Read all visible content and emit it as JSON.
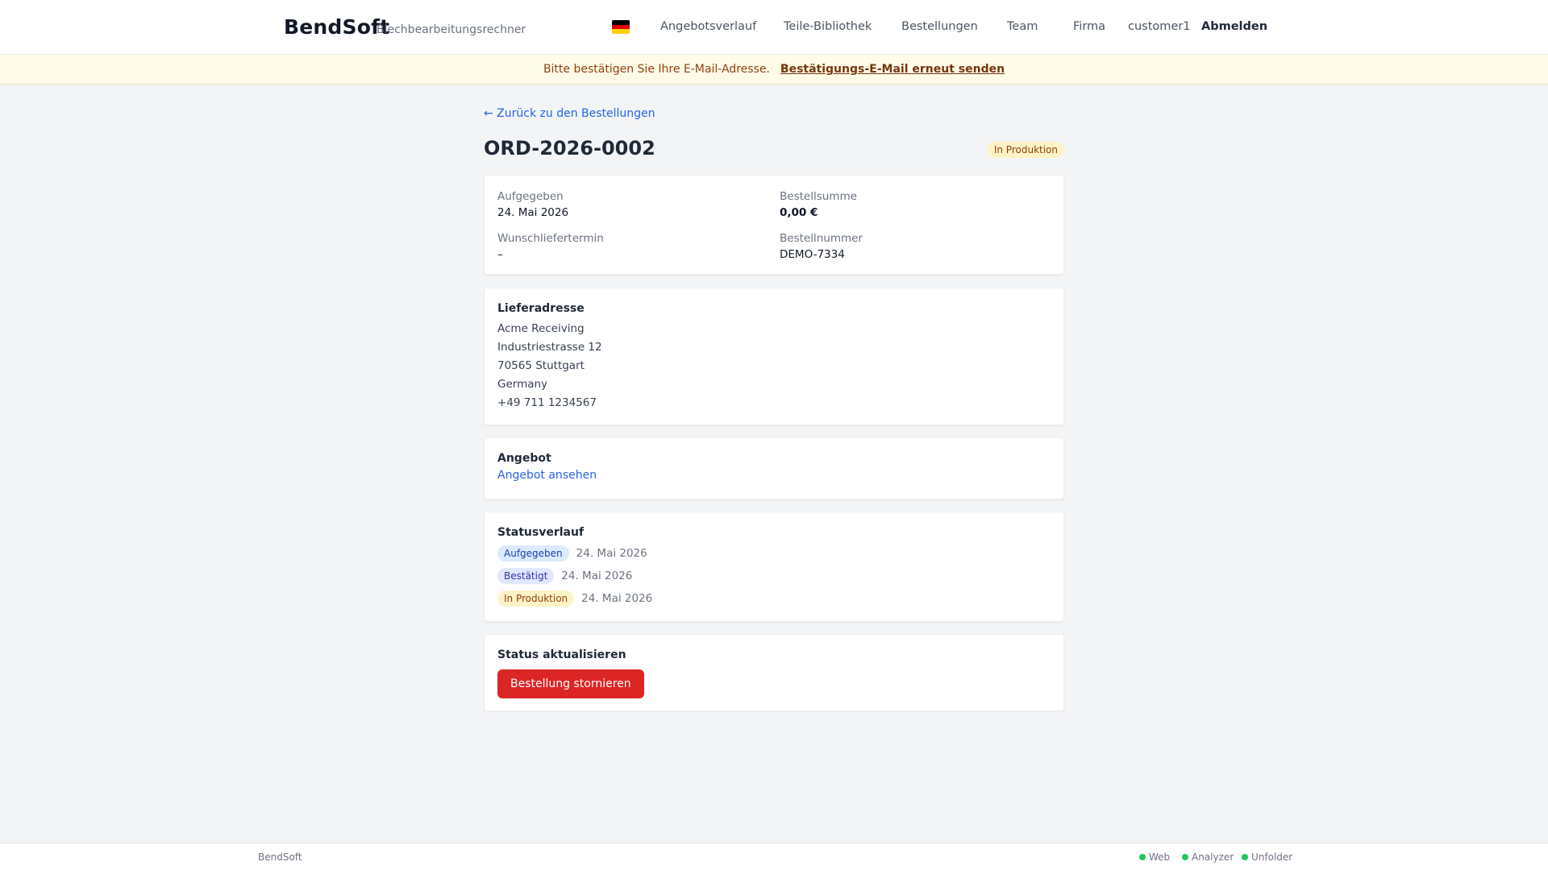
{
  "header": {
    "brand": "BendSoft",
    "subtitle": "Blechbearbeitungsrechner",
    "flag_icon": "germany-flag-icon",
    "nav": {
      "angebotsverlauf": "Angebotsverlauf",
      "teile": "Teile-Bibliothek",
      "bestellungen": "Bestellungen",
      "team": "Team",
      "firma": "Firma",
      "user": "customer1",
      "logout": "Abmelden"
    }
  },
  "banner": {
    "text": "Bitte bestätigen Sie Ihre E-Mail-Adresse.",
    "link": "Bestätigungs-E-Mail erneut senden"
  },
  "order": {
    "back_link": "← Zurück zu den Bestellungen",
    "number": "ORD-2026-0002",
    "status": "In Produktion",
    "summary": {
      "placed_label": "Aufgegeben",
      "placed_value": "24. Mai 2026",
      "total_label": "Bestellsumme",
      "total_value": "0,00 €",
      "delivery_label": "Wunschliefertermin",
      "delivery_value": "–",
      "ref_label": "Bestellnummer",
      "ref_value": "DEMO-7334"
    },
    "address": {
      "title": "Lieferadresse",
      "lines": [
        "Acme Receiving",
        "Industriestrasse 12",
        "70565 Stuttgart",
        "Germany",
        "+49 711 1234567"
      ]
    },
    "quote": {
      "title": "Angebot",
      "link": "Angebot ansehen"
    },
    "history": {
      "title": "Statusverlauf",
      "entries": [
        {
          "status": "Aufgegeben",
          "date": "24. Mai 2026"
        },
        {
          "status": "Bestätigt",
          "date": "24. Mai 2026"
        },
        {
          "status": "In Produktion",
          "date": "24. Mai 2026"
        }
      ]
    },
    "actions": {
      "title": "Status aktualisieren",
      "cancel_button": "Bestellung stornieren"
    }
  },
  "footer": {
    "brand": "BendSoft",
    "services": [
      "Web",
      "Analyzer",
      "Unfolder"
    ]
  },
  "colors": {
    "status_green": "#22c55e",
    "cancel_red": "#dc2626",
    "link_blue": "#2563eb",
    "banner_bg": "#fefce8"
  }
}
